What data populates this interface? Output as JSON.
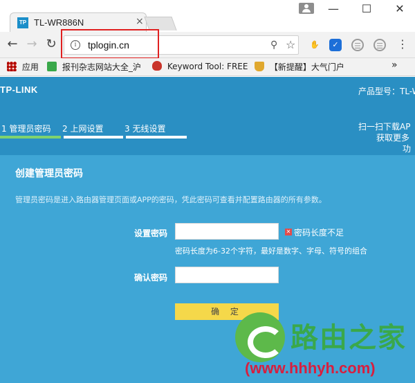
{
  "browser": {
    "tab_favicon": "TP",
    "tab_title": "TL-WR886N",
    "tab_close": "×",
    "url": "tplogin.cn",
    "window_controls": [
      "—",
      "☐",
      "✕"
    ]
  },
  "bookmarks": [
    {
      "label": "应用",
      "icon": "apps-grid-icon",
      "color": "#d0342c"
    },
    {
      "label": "报刊杂志网站大全_沪",
      "icon": "green-c-icon",
      "color": "#3aa84a"
    },
    {
      "label": "Keyword Tool: FREE",
      "icon": "red-flame-icon",
      "color": "#c9342a"
    },
    {
      "label": "【新提醒】大气门户",
      "icon": "trophy-icon",
      "color": "#e0a82e"
    }
  ],
  "router": {
    "brand": "TP-LINK",
    "model_label": "产品型号：TL-W",
    "steps": [
      "1 管理员密码",
      "2 上网设置",
      "3 无线设置"
    ],
    "scan_lines": [
      "扫一扫下载AP",
      "获取更多",
      "功"
    ],
    "card_title": "创建管理员密码",
    "card_desc": "管理员密码是进入路由器管理页面或APP的密码，凭此密码可查看并配置路由器的所有参数。",
    "password_label": "设置密码",
    "password_error": "密码长度不足",
    "password_hint": "密码长度为6-32个字符，最好是数字、字母、符号的组合",
    "confirm_label": "确认密码",
    "confirm_button": "确 定",
    "password_value": "",
    "confirm_value": ""
  },
  "watermark": {
    "title": "路由之家",
    "url": "(www.hhhyh.com)"
  },
  "colors": {
    "page_bg": "#2a8fc3",
    "card_bg": "#3fa6d6",
    "button_bg": "#f5d84a",
    "active_step": "#7fd36e",
    "highlight": "#e02020"
  }
}
